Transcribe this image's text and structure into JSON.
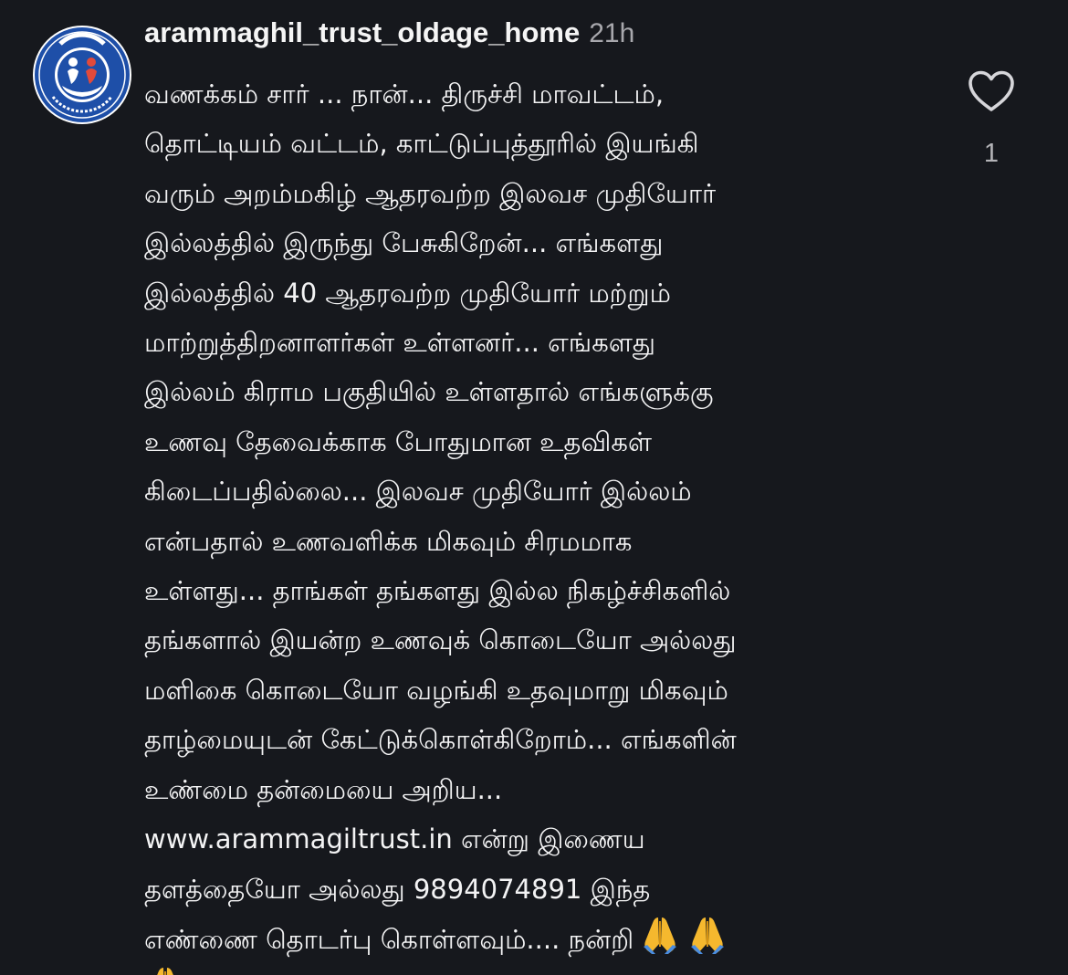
{
  "comment": {
    "username": "arammaghil_trust_oldage_home",
    "time": "21h",
    "avatar_icon": "trust-logo-icon",
    "body_lines": [
      "வணக்கம் சார் ... நான்... திருச்சி மாவட்டம்,",
      "தொட்டியம் வட்டம், காட்டுப்புத்தூரில் இயங்கி",
      "வரும் அறம்மகிழ் ஆதரவற்ற இலவச முதியோர்",
      "இல்லத்தில் இருந்து பேசுகிறேன்... எங்களது",
      "இல்லத்தில் 40 ஆதரவற்ற முதியோர் மற்றும்",
      "மாற்றுத்திறனாளர்கள் உள்ளனர்... எங்களது",
      "இல்லம் கிராம பகுதியில் உள்ளதால் எங்களுக்கு",
      "உணவு தேவைக்காக போதுமான உதவிகள்",
      "கிடைப்பதில்லை... இலவச முதியோர் இல்லம்",
      "என்பதால் உணவளிக்க மிகவும் சிரமமாக",
      "உள்ளது... தாங்கள் தங்களது இல்ல நிகழ்ச்சிகளில்",
      "தங்களால் இயன்ற உணவுக் கொடையோ அல்லது",
      "மளிகை கொடையோ வழங்கி  உதவுமாறு மிகவும்",
      "தாழ்மையுடன் கேட்டுக்கொள்கிறோம்... எங்களின்",
      "உண்மை தன்மையை அறிய...",
      "www.arammagiltrust.in என்று இணைய",
      "தளத்தையோ அல்லது 9894074891 இந்த",
      "எண்ணை தொடர்பு கொள்ளவும்.... நன்றி"
    ],
    "emoji_icon": "folded-hands-emoji",
    "like_icon": "heart-outline-icon",
    "like_count": "1"
  },
  "colors": {
    "background": "#16181d",
    "text": "#f3f3f4",
    "muted": "#a8a8ad",
    "avatar_blue": "#1e4fa8"
  }
}
